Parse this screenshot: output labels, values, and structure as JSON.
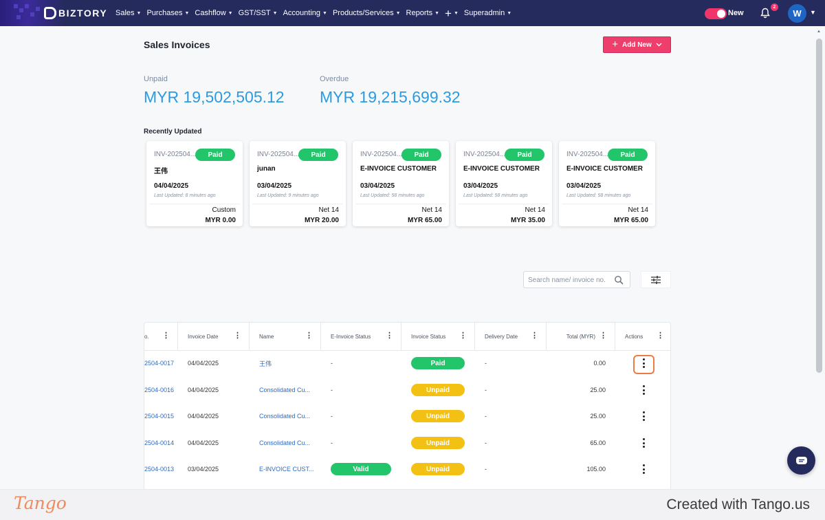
{
  "nav": {
    "logo_text": "BIZTORY",
    "menu": [
      {
        "label": "Sales"
      },
      {
        "label": "Purchases"
      },
      {
        "label": "Cashflow"
      },
      {
        "label": "GST/SST"
      },
      {
        "label": "Accounting"
      },
      {
        "label": "Products/Services"
      },
      {
        "label": "Reports"
      },
      {
        "label": "+"
      },
      {
        "label": "Superadmin"
      }
    ],
    "toggle_label": "New",
    "notification_count": "2",
    "avatar_initial": "W"
  },
  "page": {
    "title": "Sales Invoices",
    "add_new_label": "Add New"
  },
  "stats": {
    "unpaid_label": "Unpaid",
    "unpaid_value": "MYR 19,502,505.12",
    "overdue_label": "Overdue",
    "overdue_value": "MYR 19,215,699.32"
  },
  "recent": {
    "label": "Recently Updated",
    "cards": [
      {
        "invoice": "INV-202504...",
        "status": "Paid",
        "name": "王伟",
        "date": "04/04/2025",
        "updated": "Last Updated: 8 minutes ago",
        "term": "Custom",
        "amount": "MYR 0.00"
      },
      {
        "invoice": "INV-202504...",
        "status": "Paid",
        "name": "junan",
        "date": "03/04/2025",
        "updated": "Last Updated: 9 minutes ago",
        "term": "Net 14",
        "amount": "MYR 20.00"
      },
      {
        "invoice": "INV-202504...",
        "status": "Paid",
        "name": "E-INVOICE CUSTOMER",
        "date": "03/04/2025",
        "updated": "Last Updated: 58 minutes ago",
        "term": "Net 14",
        "amount": "MYR 65.00"
      },
      {
        "invoice": "INV-202504...",
        "status": "Paid",
        "name": "E-INVOICE CUSTOMER",
        "date": "03/04/2025",
        "updated": "Last Updated: 58 minutes ago",
        "term": "Net 14",
        "amount": "MYR 35.00"
      },
      {
        "invoice": "INV-202504...",
        "status": "Paid",
        "name": "E-INVOICE CUSTOMER",
        "date": "03/04/2025",
        "updated": "Last Updated: 58 minutes ago",
        "term": "Net 14",
        "amount": "MYR 65.00"
      }
    ]
  },
  "search": {
    "placeholder": "Search name/ invoice no."
  },
  "table": {
    "headers": [
      "o.",
      "Invoice Date",
      "Name",
      "E-Invoice Status",
      "Invoice Status",
      "Delivery Date",
      "Total (MYR)",
      "Actions"
    ],
    "rows": [
      {
        "no": "2504-0017",
        "date": "04/04/2025",
        "name": "王伟",
        "einvoice": "-",
        "status": "Paid",
        "delivery": "-",
        "total": "0.00"
      },
      {
        "no": "2504-0016",
        "date": "04/04/2025",
        "name": "Consolidated Cu...",
        "einvoice": "-",
        "status": "Unpaid",
        "delivery": "-",
        "total": "25.00"
      },
      {
        "no": "2504-0015",
        "date": "04/04/2025",
        "name": "Consolidated Cu...",
        "einvoice": "-",
        "status": "Unpaid",
        "delivery": "-",
        "total": "25.00"
      },
      {
        "no": "2504-0014",
        "date": "04/04/2025",
        "name": "Consolidated Cu...",
        "einvoice": "-",
        "status": "Unpaid",
        "delivery": "-",
        "total": "65.00"
      },
      {
        "no": "2504-0013",
        "date": "03/04/2025",
        "name": "E-INVOICE CUST...",
        "einvoice": "Valid",
        "status": "Unpaid",
        "delivery": "-",
        "total": "105.00"
      }
    ]
  },
  "footer": {
    "logo": "Tango",
    "credit": "Created with Tango.us"
  },
  "colors": {
    "nav_bg": "#252b5c",
    "accent_pink": "#ee3e6b",
    "stat_blue": "#2b9be0",
    "paid_green": "#22c56a",
    "unpaid_yellow": "#f3c114",
    "highlight_orange": "#ef7a45"
  }
}
